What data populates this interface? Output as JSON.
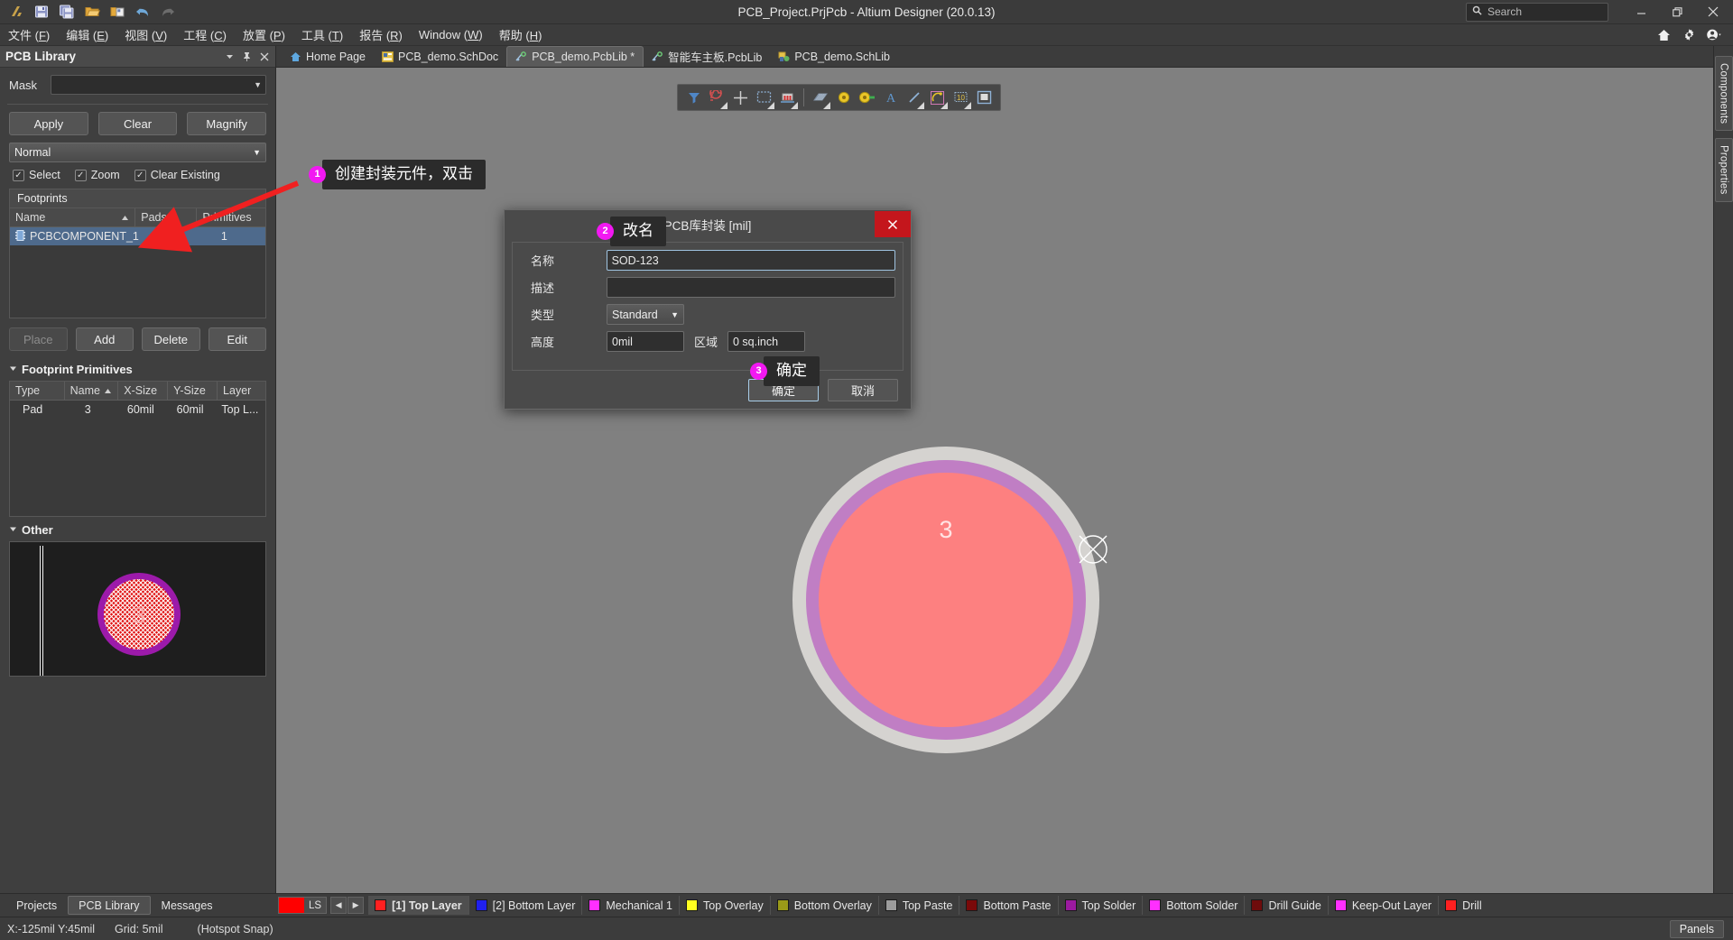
{
  "window": {
    "title": "PCB_Project.PrjPcb - Altium Designer (20.0.13)",
    "search_placeholder": "Search",
    "minimize": "—",
    "restore": "❐",
    "close": "✕"
  },
  "quick_access": [
    {
      "name": "altium-logo-icon",
      "glyph": "A"
    },
    {
      "name": "save-icon",
      "glyph": "save"
    },
    {
      "name": "save-all-icon",
      "glyph": "saveall"
    },
    {
      "name": "open-icon",
      "glyph": "open"
    },
    {
      "name": "open-project-icon",
      "glyph": "openproj"
    },
    {
      "name": "undo-icon",
      "glyph": "↶"
    },
    {
      "name": "redo-icon",
      "glyph": "↷"
    }
  ],
  "menu": {
    "items": [
      {
        "label": "文件",
        "key": "F"
      },
      {
        "label": "编辑",
        "key": "E"
      },
      {
        "label": "视图",
        "key": "V"
      },
      {
        "label": "工程",
        "key": "C"
      },
      {
        "label": "放置",
        "key": "P"
      },
      {
        "label": "工具",
        "key": "T"
      },
      {
        "label": "报告",
        "key": "R"
      },
      {
        "label": "Window",
        "key": "W"
      },
      {
        "label": "帮助",
        "key": "H"
      }
    ],
    "right_icons": [
      "home-icon",
      "gear-icon",
      "account-icon"
    ]
  },
  "left_panel": {
    "title": "PCB Library",
    "header_icons": [
      "dropdown-icon",
      "pin-icon",
      "close-icon"
    ],
    "mask": {
      "label": "Mask",
      "value": "",
      "placeholder": ""
    },
    "buttons": {
      "apply": "Apply",
      "clear": "Clear",
      "magnify": "Magnify"
    },
    "mode": "Normal",
    "checks": [
      {
        "label": "Select",
        "checked": true
      },
      {
        "label": "Zoom",
        "checked": true
      },
      {
        "label": "Clear Existing",
        "checked": true
      }
    ],
    "footprints": {
      "group_title": "Footprints",
      "columns": [
        "Name",
        "Pads",
        "Primitives"
      ],
      "sort_column": "Name",
      "rows": [
        {
          "name": "PCBCOMPONENT_1",
          "pads": "1",
          "primitives": "1",
          "selected": true
        }
      ]
    },
    "list_buttons": [
      {
        "label": "Place",
        "disabled": true
      },
      {
        "label": "Add",
        "disabled": false
      },
      {
        "label": "Delete",
        "disabled": false
      },
      {
        "label": "Edit",
        "disabled": false
      }
    ],
    "primitives": {
      "section_title": "Footprint Primitives",
      "columns": [
        "Type",
        "Name",
        "X-Size",
        "Y-Size",
        "Layer"
      ],
      "sort_column": "Name",
      "rows": [
        {
          "type": "Pad",
          "name": "3",
          "xsize": "60mil",
          "ysize": "60mil",
          "layer": "Top L..."
        }
      ]
    },
    "other": {
      "section_title": "Other",
      "preview_pad_label": "3"
    }
  },
  "document_tabs": [
    {
      "label": "Home Page",
      "icon": "home-icon",
      "active": false,
      "modified": false
    },
    {
      "label": "PCB_demo.SchDoc",
      "icon": "schdoc-icon",
      "active": false,
      "modified": false
    },
    {
      "label": "PCB_demo.PcbLib *",
      "icon": "pcblib-icon",
      "active": true,
      "modified": true
    },
    {
      "label": "智能车主板.PcbLib",
      "icon": "pcblib-icon",
      "active": false,
      "modified": false
    },
    {
      "label": "PCB_demo.SchLib",
      "icon": "schlib-icon",
      "active": false,
      "modified": false
    }
  ],
  "canvas_toolbar": [
    {
      "name": "filter-icon"
    },
    {
      "name": "magnet-icon"
    },
    {
      "name": "crosshair-icon"
    },
    {
      "name": "select-area-icon"
    },
    {
      "name": "place-component-icon"
    },
    {
      "name": "place-polygon-icon"
    },
    {
      "name": "place-pad-icon"
    },
    {
      "name": "place-via-icon"
    },
    {
      "name": "place-string-icon"
    },
    {
      "name": "place-line-icon"
    },
    {
      "name": "place-arc-icon"
    },
    {
      "name": "place-dimension-icon"
    },
    {
      "name": "place-fill-icon"
    }
  ],
  "canvas": {
    "pad_label": "3",
    "colors": {
      "background": "#808080",
      "pad_fill": "#fd8080",
      "pad_solder_ring": "#c07ec4",
      "pad_paste_ring": "#d5d3d0"
    }
  },
  "right_dock": {
    "tabs": [
      "Components",
      "Properties"
    ]
  },
  "dialog": {
    "title": "PCB库封装 [mil]",
    "close_label": "✕",
    "fields": [
      {
        "label": "名称",
        "value": "SOD-123",
        "type": "text",
        "focused": true
      },
      {
        "label": "描述",
        "value": "",
        "type": "text",
        "focused": false
      },
      {
        "label": "类型",
        "value": "Standard",
        "type": "combo",
        "focused": false
      }
    ],
    "height": {
      "label": "高度",
      "value": "0mil"
    },
    "area": {
      "label": "区域",
      "value": "0 sq.inch"
    },
    "ok": "确定",
    "cancel": "取消"
  },
  "annotations": [
    {
      "number": "1",
      "text": "创建封装元件，双击"
    },
    {
      "number": "2",
      "text": "改名"
    },
    {
      "number": "3",
      "text": "确定"
    }
  ],
  "layer_bar": {
    "ls_label": "LS",
    "ls_color": "#ff0000",
    "prev": "◀",
    "next": "▶",
    "layers": [
      {
        "label": "[1] Top Layer",
        "color": "#ff2020",
        "active": true
      },
      {
        "label": "[2] Bottom Layer",
        "color": "#2020ee",
        "active": false
      },
      {
        "label": "Mechanical 1",
        "color": "#ff2fff",
        "active": false
      },
      {
        "label": "Top Overlay",
        "color": "#ffff20",
        "active": false
      },
      {
        "label": "Bottom Overlay",
        "color": "#9a9a18",
        "active": false
      },
      {
        "label": "Top Paste",
        "color": "#9c9c9c",
        "active": false
      },
      {
        "label": "Bottom Paste",
        "color": "#7a0a0a",
        "active": false
      },
      {
        "label": "Top Solder",
        "color": "#9b1aa0",
        "active": false
      },
      {
        "label": "Bottom Solder",
        "color": "#ff2fff",
        "active": false
      },
      {
        "label": "Drill Guide",
        "color": "#6e0c0c",
        "active": false
      },
      {
        "label": "Keep-Out Layer",
        "color": "#ff2fff",
        "active": false
      },
      {
        "label": "Drill",
        "color": "#ff2020",
        "active": false
      }
    ]
  },
  "panel_tabs": [
    {
      "label": "Projects",
      "active": false
    },
    {
      "label": "PCB Library",
      "active": true
    },
    {
      "label": "Messages",
      "active": false
    }
  ],
  "status_bar": {
    "coords": "X:-125mil Y:45mil",
    "grid": "Grid: 5mil",
    "snap": "(Hotspot Snap)",
    "panels": "Panels"
  }
}
